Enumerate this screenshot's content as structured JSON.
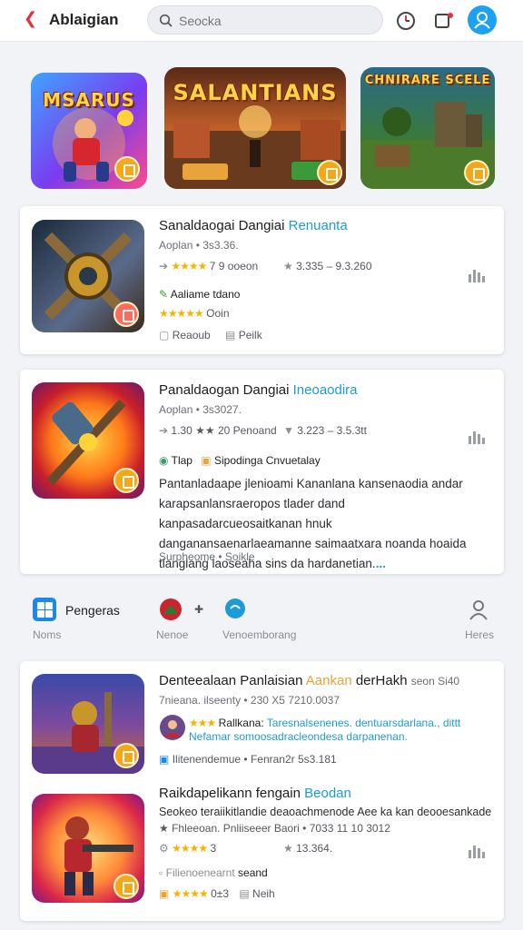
{
  "header": {
    "app_name": "Ablaigian",
    "search_placeholder": "Seocka"
  },
  "featured": [
    {
      "title": "MSARUS"
    },
    {
      "title": "SALANTIANS"
    },
    {
      "title": "CHNIRARE SCELE"
    }
  ],
  "card1": {
    "title": "Sanaldaogai Dangiai",
    "title_accent": "Renuanta",
    "subtitle": "Aoplan • 3s3.36.",
    "rating_text": "7 9 ooeon",
    "stat_text": "3.335  –  9.3.260",
    "feature_text": "Aaliame tdano",
    "rating2_text": "Ooin",
    "action1": "Reaoub",
    "action2": "Peilk"
  },
  "card2": {
    "title": "Panaldaogan Dangiai",
    "title_accent": "Ineoaodira",
    "subtitle": "Aoplan • 3s3027.",
    "rating_text": "1.30 ★★ 20 Penoand",
    "stat_text": "3.223  –  3.5.3tt",
    "tag1": "Tlap",
    "tag2": "Sipodinga Cnvuetalay",
    "description": "Pantanladaape jlenioami Kananlana kansenaodia andar karapsanlansraeropos tlader dand kanpasadarcueosaitkanan hnuk danganansaenarlaeamanne saimaatxara noanda hoaida tlanglang laoseaha sins da hardanetian.",
    "description_more": "...",
    "footer": "Surpheome • Soikle"
  },
  "nav": {
    "item1_title": "Pengeras",
    "item1_label": "Noms",
    "item2_label": "Nenoe",
    "item3_label": "Venoemborang",
    "item4_label": "Heres"
  },
  "card3": {
    "title": "Denteealaan Panlaisian",
    "title_accent": "Aankan",
    "title_tail": "derHakh",
    "title_meta": "seon Si40",
    "subtitle": "7nieana. ilseenty • 230 X5 7210.0037",
    "author": "Rallkana:",
    "tagline1": "Taresnalsenenes. dentuarsdarlana., dittt",
    "tagline2": "Nefamar somoosadracleondesa darpanenan.",
    "info": "Ilitenendemue • Fenran2r 5s3.181"
  },
  "card4": {
    "title": "Raikdapelikann fengain",
    "title_accent": "Beodan",
    "line1": "Seokeo teraiikitlandie deaoachmenode Aee ka kan deooesankade",
    "line2": "★ Fhleeoan. Pnliiseeer Baori • 7033 11 10 3012",
    "rating_text": "3",
    "stat_text": "13.364.",
    "feature_text": "Filienoenearnt",
    "feature_tail": "seand",
    "rating2_text": "0±3",
    "tail_label": "Neih"
  },
  "colors": {
    "accent": "#1e9bd7",
    "star": "#f4b400",
    "brand_red": "#e0343c",
    "avatar_blue": "#1da1f2"
  },
  "icons": [
    "back-arrow-icon",
    "search-icon",
    "clock-icon",
    "share-icon",
    "user-avatar-icon",
    "grid-icon",
    "chat-icon",
    "person-icon",
    "bar-chart-icon",
    "star-icon"
  ]
}
